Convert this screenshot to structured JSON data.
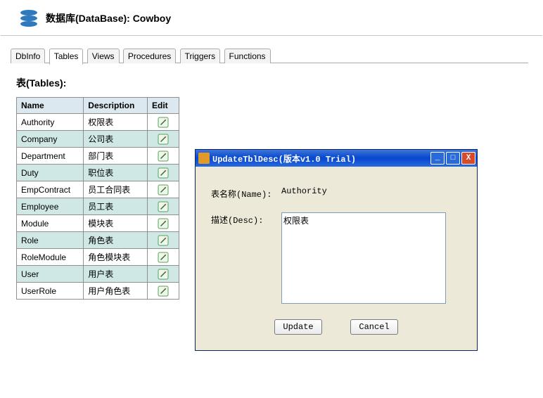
{
  "header": {
    "title": "数据库(DataBase): Cowboy"
  },
  "tabs": [
    {
      "id": "dbinfo",
      "label": "DbInfo"
    },
    {
      "id": "tables",
      "label": "Tables",
      "active": true
    },
    {
      "id": "views",
      "label": "Views"
    },
    {
      "id": "procedures",
      "label": "Procedures"
    },
    {
      "id": "triggers",
      "label": "Triggers"
    },
    {
      "id": "functions",
      "label": "Functions"
    }
  ],
  "section": {
    "heading": "表(Tables):"
  },
  "table_headers": {
    "name": "Name",
    "description": "Description",
    "edit": "Edit"
  },
  "tables": [
    {
      "name": "Authority",
      "desc": "权限表"
    },
    {
      "name": "Company",
      "desc": "公司表"
    },
    {
      "name": "Department",
      "desc": "部门表"
    },
    {
      "name": "Duty",
      "desc": "职位表"
    },
    {
      "name": "EmpContract",
      "desc": "员工合同表"
    },
    {
      "name": "Employee",
      "desc": "员工表"
    },
    {
      "name": "Module",
      "desc": "模块表"
    },
    {
      "name": "Role",
      "desc": "角色表"
    },
    {
      "name": "RoleModule",
      "desc": "角色模块表"
    },
    {
      "name": "User",
      "desc": "用户表"
    },
    {
      "name": "UserRole",
      "desc": "用户角色表"
    }
  ],
  "dialog": {
    "title": "UpdateTblDesc(版本v1.0 Trial)",
    "fields": {
      "name_label": "表名称(Name):",
      "name_value": "Authority",
      "desc_label": "描述(Desc):",
      "desc_value": "权限表"
    },
    "buttons": {
      "update": "Update",
      "cancel": "Cancel"
    }
  }
}
